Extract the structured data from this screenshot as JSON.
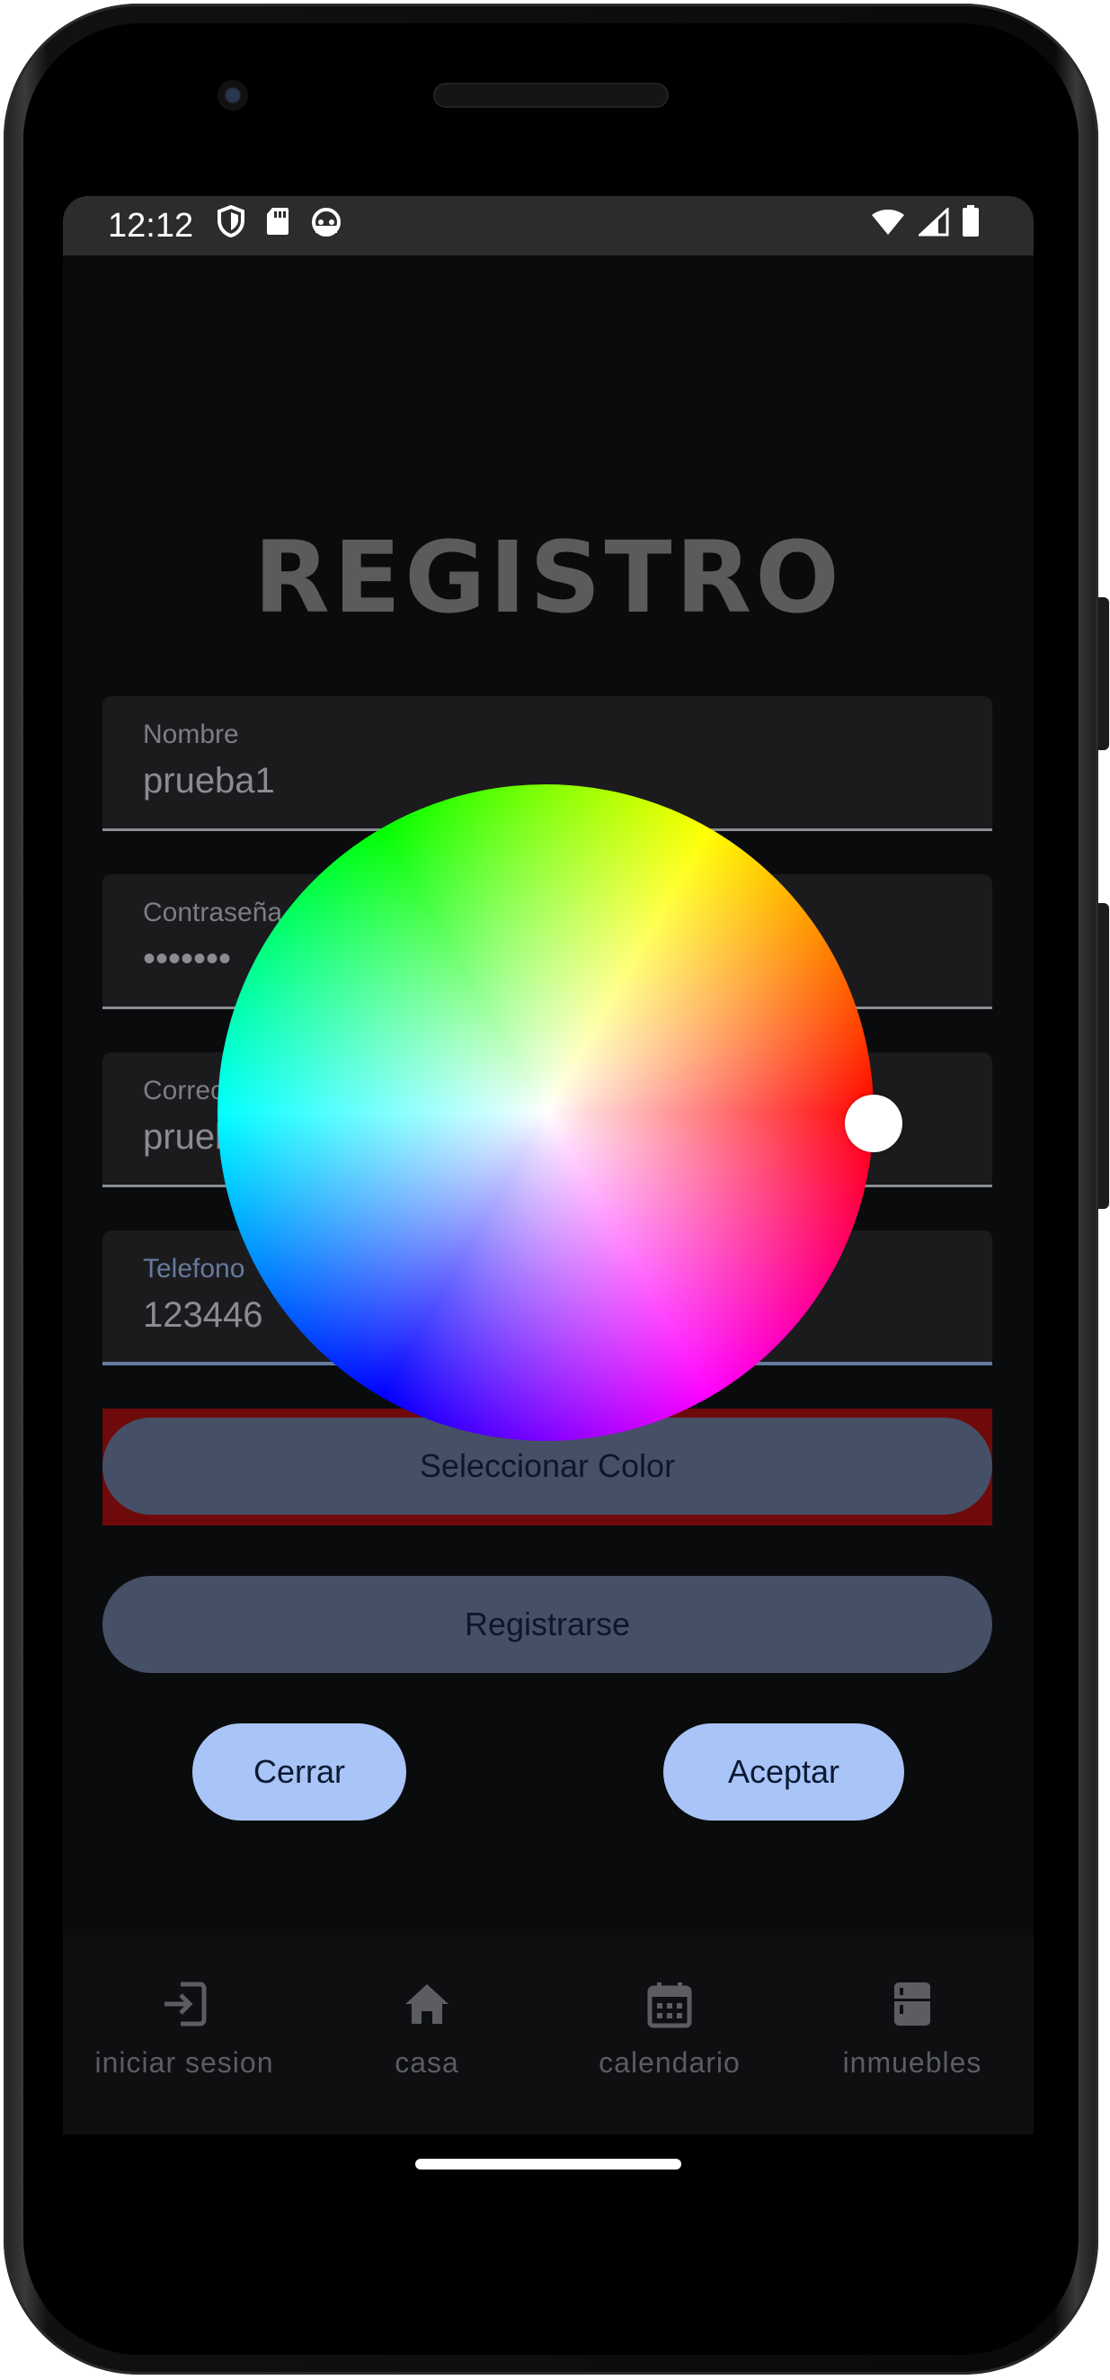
{
  "status_bar": {
    "time": "12:12",
    "left_icons": [
      "shield-icon",
      "sd-card-icon",
      "android-icon"
    ],
    "right_icons": [
      "wifi-icon",
      "signal-icon",
      "battery-icon"
    ]
  },
  "page": {
    "title": "REGISTRO"
  },
  "form": {
    "nombre": {
      "label": "Nombre",
      "value": "prueba1"
    },
    "contrasena": {
      "label": "Contraseña",
      "value": "•••••••"
    },
    "correo": {
      "label": "Correo",
      "value": "prueba1@gmail.com"
    },
    "telefono": {
      "label": "Telefono",
      "value": "123446"
    }
  },
  "buttons": {
    "select_color": "Seleccionar Color",
    "register": "Registrarse",
    "close": "Cerrar",
    "accept": "Aceptar"
  },
  "color_picker": {
    "selected_hue_deg": 0,
    "selected_color": "#ff0000"
  },
  "bottom_nav": {
    "items": [
      {
        "label": "iniciar sesion",
        "icon": "login-icon"
      },
      {
        "label": "casa",
        "icon": "home-icon"
      },
      {
        "label": "calendario",
        "icon": "calendar-icon"
      },
      {
        "label": "inmuebles",
        "icon": "fridge-icon"
      }
    ]
  },
  "colors": {
    "screen_bg": "#0a0b0d",
    "field_bg": "#1b1b1e",
    "primary_button": "#454f66",
    "secondary_button": "#a9c4f7",
    "highlight": "#6e0a0a"
  }
}
